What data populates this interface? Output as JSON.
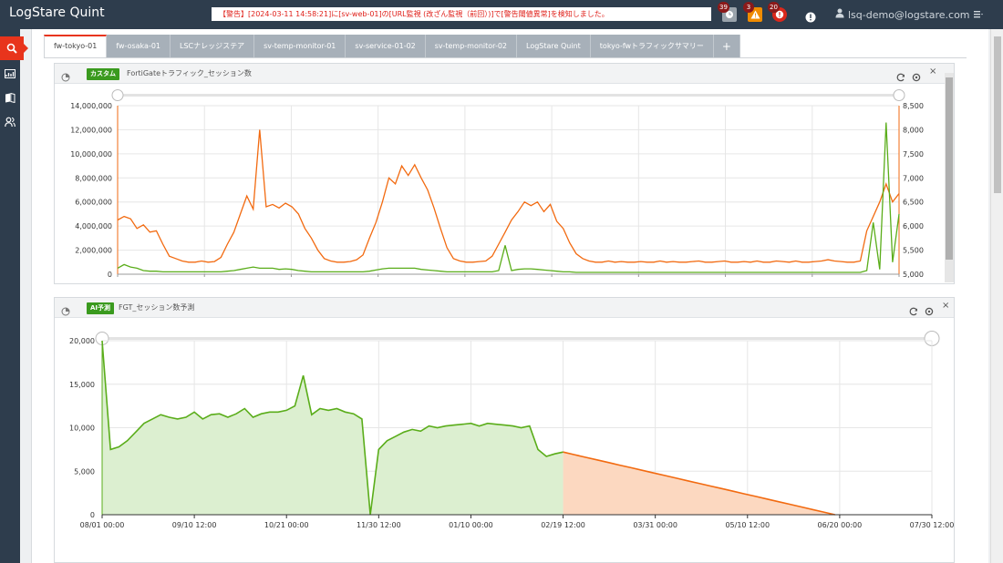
{
  "app": {
    "title": "LogStare Quint"
  },
  "header": {
    "alert_text": "【警告】[2024-03-11 14:58:21]に[sv-web-01]の[URL監視 (改ざん監視（前回）)]で[警告閾値異常]を検知しました。",
    "badges": {
      "gray": "39",
      "orange": "3",
      "red": "20"
    },
    "user": "lsq-demo@logstare.com"
  },
  "tabs": [
    {
      "label": "fw-tokyo-01",
      "active": true
    },
    {
      "label": "fw-osaka-01"
    },
    {
      "label": "LSCナレッジステア"
    },
    {
      "label": "sv-temp-monitor-01"
    },
    {
      "label": "sv-service-01-02"
    },
    {
      "label": "sv-temp-monitor-02"
    },
    {
      "label": "LogStare Quint"
    },
    {
      "label": "tokyo-fwトラフィックサマリー"
    },
    {
      "label": "+"
    }
  ],
  "panels": [
    {
      "tag": "カスタム",
      "title": "FortiGateトラフィック_セッション数"
    },
    {
      "tag": "AI予測",
      "title": "FGT_セッション数予測"
    }
  ],
  "chart_data": [
    {
      "type": "line",
      "title": "FortiGateトラフィック_セッション数",
      "ylim": [
        0,
        14000000
      ],
      "y_ticks": [
        "14,000,000",
        "12,000,000",
        "10,000,000",
        "8,000,000",
        "6,000,000",
        "4,000,000",
        "2,000,000",
        "0"
      ],
      "y2lim": [
        5000,
        8500
      ],
      "y2_ticks": [
        "8,500",
        "8,000",
        "7,500",
        "7,000",
        "6,500",
        "6,000",
        "5,500",
        "5,000"
      ],
      "grid": true,
      "series": [
        {
          "color": "#f26a10",
          "values": [
            4500000,
            4800000,
            4600000,
            3800000,
            4100000,
            3500000,
            3600000,
            2500000,
            1500000,
            1300000,
            1100000,
            1000000,
            1000000,
            1100000,
            1000000,
            1050000,
            1400000,
            2500000,
            3500000,
            5000000,
            6500000,
            5400000,
            12000000,
            5600000,
            5800000,
            5500000,
            5900000,
            5600000,
            5000000,
            3800000,
            3000000,
            2000000,
            1300000,
            1100000,
            1000000,
            1000000,
            1050000,
            1200000,
            1600000,
            3000000,
            4300000,
            6000000,
            8000000,
            7500000,
            9000000,
            8200000,
            9100000,
            8000000,
            7000000,
            5500000,
            3800000,
            2200000,
            1300000,
            1100000,
            1000000,
            1000000,
            1050000,
            1100000,
            1500000,
            2500000,
            3500000,
            4500000,
            5200000,
            6000000,
            5700000,
            6000000,
            5200000,
            5800000,
            4400000,
            3800000,
            2600000,
            1700000,
            1300000,
            1100000,
            1000000,
            1000000,
            1100000,
            1000000,
            1050000,
            1000000,
            1000000,
            1050000,
            1000000,
            1000000,
            1100000,
            1000000,
            1050000,
            1000000,
            1000000,
            1050000,
            1100000,
            1000000,
            1000000,
            1050000,
            1100000,
            1000000,
            1000000,
            1050000,
            1000000,
            1100000,
            1000000,
            1000000,
            1100000,
            1050000,
            1000000,
            1100000,
            1000000,
            1000000,
            1050000,
            1100000,
            1200000,
            1100000,
            1050000,
            1000000,
            1000000,
            1100000,
            3600000,
            4800000,
            6000000,
            7500000,
            6000000,
            6700000
          ]
        },
        {
          "color": "#5aad1a",
          "values": [
            500000,
            800000,
            600000,
            500000,
            300000,
            250000,
            250000,
            200000,
            200000,
            200000,
            200000,
            200000,
            200000,
            200000,
            200000,
            200000,
            200000,
            250000,
            300000,
            400000,
            500000,
            600000,
            500000,
            500000,
            500000,
            400000,
            450000,
            400000,
            300000,
            250000,
            200000,
            200000,
            200000,
            200000,
            200000,
            200000,
            200000,
            200000,
            200000,
            250000,
            350000,
            450000,
            500000,
            500000,
            500000,
            500000,
            500000,
            400000,
            350000,
            300000,
            250000,
            200000,
            200000,
            200000,
            200000,
            200000,
            200000,
            200000,
            200000,
            300000,
            2400000,
            300000,
            400000,
            450000,
            450000,
            400000,
            350000,
            300000,
            250000,
            200000,
            200000,
            150000,
            150000,
            150000,
            150000,
            150000,
            150000,
            150000,
            150000,
            150000,
            150000,
            150000,
            150000,
            150000,
            150000,
            150000,
            150000,
            150000,
            150000,
            150000,
            150000,
            150000,
            150000,
            150000,
            150000,
            150000,
            150000,
            150000,
            150000,
            150000,
            150000,
            150000,
            150000,
            150000,
            150000,
            150000,
            150000,
            150000,
            150000,
            150000,
            150000,
            150000,
            150000,
            150000,
            150000,
            150000,
            300000,
            4300000,
            400000,
            12600000,
            1000000,
            5000000
          ]
        }
      ]
    },
    {
      "type": "area",
      "title": "FGT_セッション数予測",
      "ylim": [
        0,
        20000
      ],
      "y_ticks": [
        "20,000",
        "15,000",
        "10,000",
        "5,000",
        "0"
      ],
      "x_ticks": [
        "08/01 00:00",
        "09/10 12:00",
        "10/21 00:00",
        "11/30 12:00",
        "01/10 00:00",
        "02/19 12:00",
        "03/31 00:00",
        "05/10 12:00",
        "06/20 00:00",
        "07/30 12:00"
      ],
      "grid": true,
      "series": [
        {
          "color": "#5aad1a",
          "fill": "#dcefd0",
          "values": [
            20000,
            7500,
            7800,
            8500,
            9500,
            10500,
            11000,
            11500,
            11200,
            11000,
            11200,
            11800,
            11000,
            11500,
            11600,
            11200,
            11600,
            12200,
            11200,
            11600,
            11800,
            11800,
            12000,
            12500,
            16000,
            11500,
            12200,
            12000,
            12200,
            11800,
            11600,
            11000,
            0,
            7500,
            8500,
            9000,
            9500,
            9800,
            9600,
            10200,
            10000,
            10200,
            10300,
            10400,
            10500,
            10200,
            10500,
            10400,
            10300,
            10200,
            10000,
            10200,
            7500,
            6700,
            7000,
            7200
          ]
        },
        {
          "color": "#f26a10",
          "fill": "#fcd8c0",
          "values": [
            7200,
            6900,
            6600,
            6300,
            6000,
            5700,
            5400,
            5100,
            4800,
            4500,
            4200,
            3900,
            3600,
            3300,
            3000,
            2700,
            2400,
            2100,
            1800,
            1500,
            1200,
            900,
            600,
            300,
            0
          ]
        }
      ]
    }
  ]
}
